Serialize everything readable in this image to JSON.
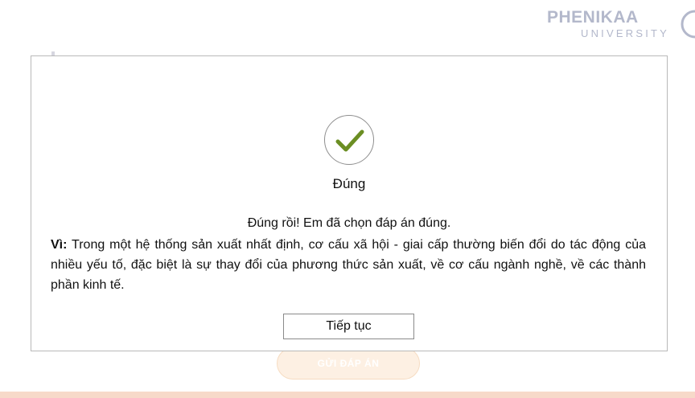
{
  "logo": {
    "name": "PHENIKAA",
    "subtitle": "UNIVERSITY"
  },
  "background": {
    "submit_label": "GỬI ĐÁP ÁN"
  },
  "dialog": {
    "icon": "check-icon",
    "title": "Đúng",
    "message": "Đúng rồi! Em đã chọn đáp án đúng.",
    "explanation_label": "Vì:",
    "explanation_text": " Trong một hệ thống sản xuất nhất định, cơ cấu xã hội - giai cấp thường biến đổi do tác động của nhiều yếu tố, đặc biệt là sự thay đổi của phương thức sản xuất, về cơ cấu ngành nghề, về các thành phần kinh tế.",
    "continue_label": "Tiếp tục"
  },
  "colors": {
    "check": "#6b8e23",
    "logo": "#b3b8cb",
    "submit_bg": "#fdf0e3",
    "bottom_bar": "#f7d9c9"
  }
}
